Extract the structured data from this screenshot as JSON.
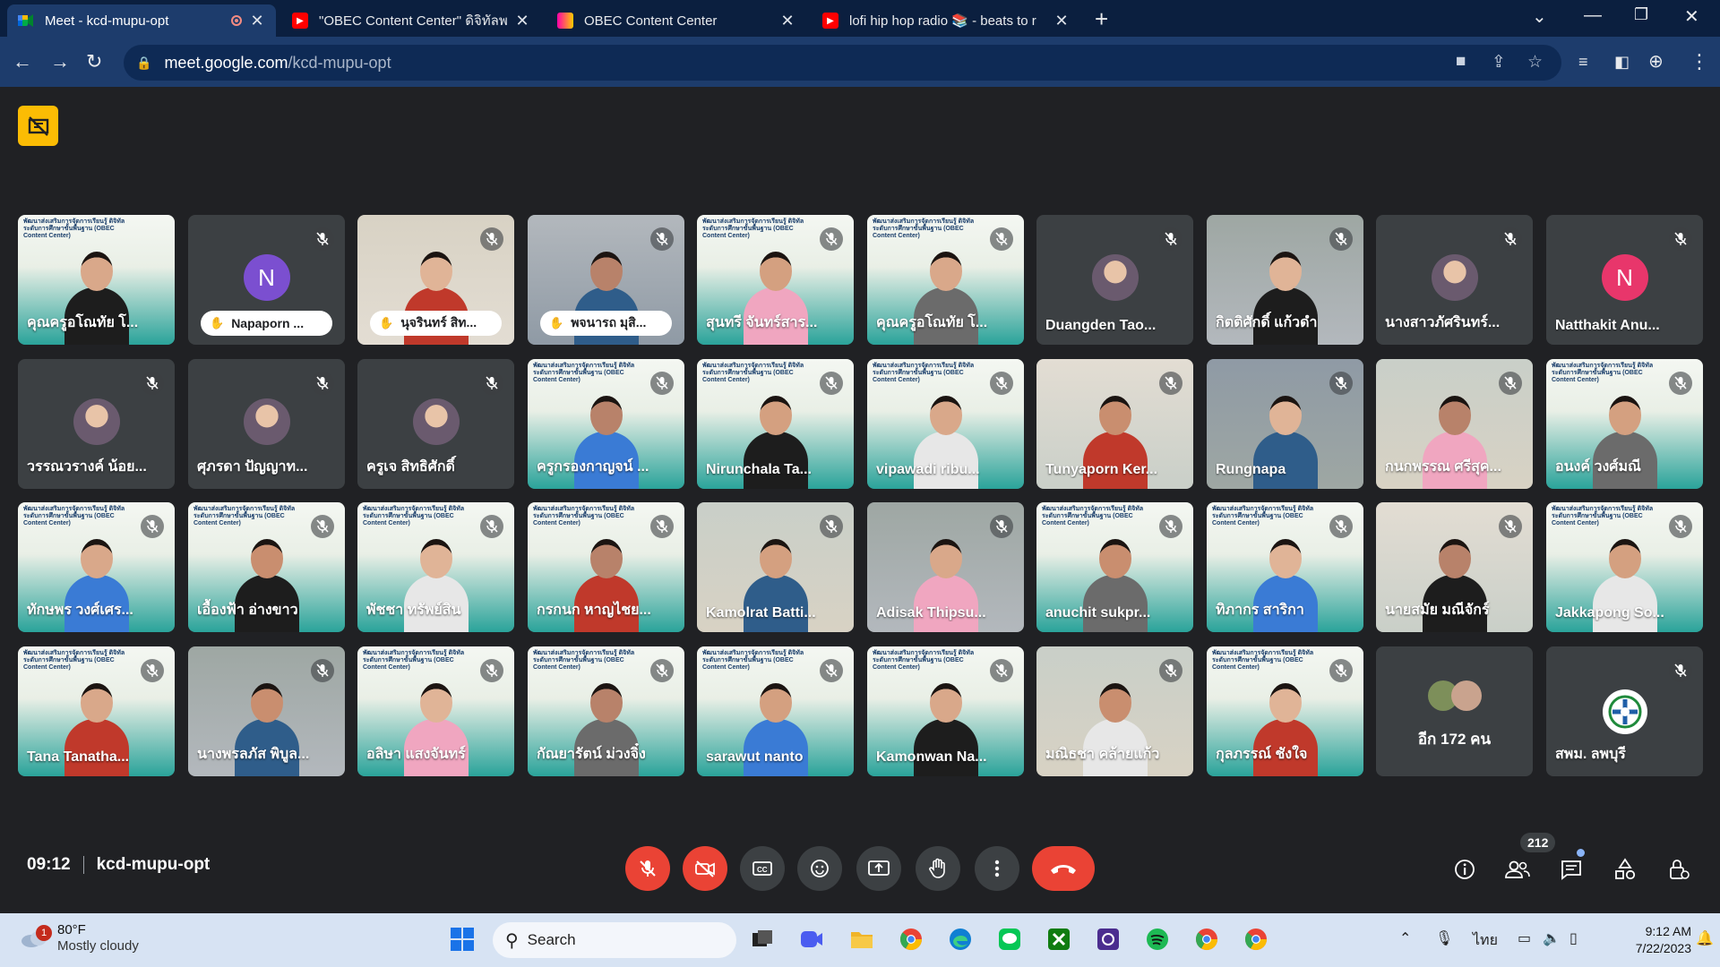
{
  "browser": {
    "tabs": [
      {
        "title": "Meet - kcd-mupu-opt",
        "active": true,
        "recording": true
      },
      {
        "title": "\"OBEC Content Center\" ดิจิทัลพลเ",
        "active": false
      },
      {
        "title": "OBEC Content Center",
        "active": false
      },
      {
        "title": "lofi hip hop radio 📚 - beats to r",
        "active": false
      }
    ],
    "url_host": "meet.google.com",
    "url_path": "/kcd-mupu-opt"
  },
  "participants": [
    {
      "name": "คุณครูอโณทัย โ...",
      "type": "video-banner",
      "muted": false
    },
    {
      "name": "Napaporn ...",
      "type": "avatar-letter",
      "letter": "N",
      "avatar_color": "#7b4fd0",
      "hand_raised": true,
      "muted": true
    },
    {
      "name": "นุจรินทร์ สิท...",
      "type": "video",
      "hand_raised": true,
      "muted": true
    },
    {
      "name": "พจนารถ มุสิ...",
      "type": "video",
      "hand_raised": true,
      "muted": true
    },
    {
      "name": "สุนทรี จันทร์สาร...",
      "type": "video-banner",
      "muted": true
    },
    {
      "name": "คุณครูอโณทัย โ...",
      "type": "video-banner",
      "muted": true
    },
    {
      "name": "Duangden Tao...",
      "type": "avatar-photo",
      "muted": true
    },
    {
      "name": "กิตติศักดิ์ แก้วดำ",
      "type": "video",
      "muted": true
    },
    {
      "name": "นางสาวภัศรินทร์...",
      "type": "avatar-photo",
      "muted": true
    },
    {
      "name": "Natthakit Anu...",
      "type": "avatar-letter",
      "letter": "N",
      "avatar_color": "#e8366b",
      "muted": true
    },
    {
      "name": "วรรณวรางค์ น้อย...",
      "type": "avatar-photo",
      "muted": true
    },
    {
      "name": "ศุภรดา ปัญญาท...",
      "type": "avatar-photo",
      "muted": true
    },
    {
      "name": "ครูเจ สิทธิศักดิ์",
      "type": "avatar-photo",
      "muted": true
    },
    {
      "name": "ครูกรองกาญจน์ ...",
      "type": "video-banner",
      "muted": true
    },
    {
      "name": "Nirunchala Ta...",
      "type": "video-banner",
      "muted": true
    },
    {
      "name": "vipawadi ribu...",
      "type": "video-banner",
      "muted": true
    },
    {
      "name": "Tunyaporn Ker...",
      "type": "video",
      "muted": true
    },
    {
      "name": "Rungnapa",
      "type": "video",
      "muted": true
    },
    {
      "name": "กนกพรรณ ศรีสุค...",
      "type": "video",
      "muted": true
    },
    {
      "name": "อนงค์ วงศ์มณี",
      "type": "video-banner",
      "muted": true
    },
    {
      "name": "ทักษพร วงศ์เศร...",
      "type": "video-banner",
      "muted": true
    },
    {
      "name": "เอื้องฟ้า อ่างขาว",
      "type": "video-banner",
      "muted": true
    },
    {
      "name": "พัชชา ทรัพย์สิน",
      "type": "video-banner",
      "muted": true
    },
    {
      "name": "กรกนก หาญไชย...",
      "type": "video-banner",
      "muted": true
    },
    {
      "name": "Kamolrat Batti...",
      "type": "video",
      "muted": true
    },
    {
      "name": "Adisak Thipsu...",
      "type": "video",
      "muted": true
    },
    {
      "name": "anuchit sukpr...",
      "type": "video-banner",
      "muted": true
    },
    {
      "name": "ทิภากร สาริกา",
      "type": "video-banner",
      "muted": true
    },
    {
      "name": "นายสมัย มณีจักร์",
      "type": "video",
      "muted": true
    },
    {
      "name": "Jakkapong So...",
      "type": "video-banner",
      "muted": true
    },
    {
      "name": "Tana Tanatha...",
      "type": "video-banner",
      "muted": true
    },
    {
      "name": "นางพรลภัส พิบูล...",
      "type": "video",
      "muted": true
    },
    {
      "name": "อลิษา แสงจันทร์",
      "type": "video-banner",
      "muted": true
    },
    {
      "name": "กัณยารัตน์ ม่วงจิ๋ง",
      "type": "video-banner",
      "muted": true
    },
    {
      "name": "sarawut nanto",
      "type": "video-banner",
      "muted": true
    },
    {
      "name": "Kamonwan Na...",
      "type": "video-banner",
      "muted": true
    },
    {
      "name": "มณิธชา คล้ายแก้ว",
      "type": "video",
      "muted": true
    },
    {
      "name": "กุลภรรณ์ ชังใจ",
      "type": "video-banner",
      "muted": true
    },
    {
      "name": "อีก 172 คน",
      "type": "others",
      "muted": false
    },
    {
      "name": "สพม. ลพบุรี",
      "type": "logo",
      "muted": true
    }
  ],
  "banner_text": "พัฒนาส่งเสริมการจัดการเรียนรู้ ดิจิทัล ระดับการศึกษาขั้นพื้นฐาน (OBEC Content Center)",
  "meeting": {
    "time": "09:12",
    "code": "kcd-mupu-opt",
    "participant_count": "212"
  },
  "taskbar": {
    "weather_temp": "80°F",
    "weather_desc": "Mostly cloudy",
    "weather_alert": "1",
    "search_placeholder": "Search",
    "lang": "ไทย",
    "time": "9:12 AM",
    "date": "7/22/2023"
  },
  "colors": {
    "end_call": "#ea4335",
    "tile_bg": "#3c4043",
    "banner_teal": "#2aa39a"
  }
}
